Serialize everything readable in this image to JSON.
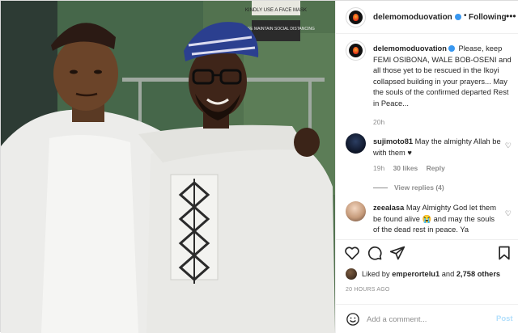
{
  "post": {
    "username": "delemomoduovation",
    "header_separator": "•",
    "follow_label": "Following",
    "more_icon": "more-icon",
    "photo_alt": "photo"
  },
  "caption": {
    "username": "delemomoduovation",
    "text": "Please, keep FEMI OSIBONA, WALE BOB-OSENI and all those yet to be rescued in the Ikoyi collapsed building in your prayers... May the souls of the confirmed departed Rest in Peace...",
    "time": "20h"
  },
  "comments": [
    {
      "username": "sujimoto81",
      "text": "May the almighty Allah be with them ♥",
      "time": "19h",
      "likes": "30 likes",
      "reply_label": "Reply",
      "view_replies": "View replies (4)"
    },
    {
      "username": "zeealasa",
      "text": "May Almighty God let them be found alive 😭 and may the souls of the dead rest in peace. Ya"
    }
  ],
  "actions": {
    "icons": [
      "heart-icon",
      "comment-icon",
      "share-icon",
      "bookmark-icon"
    ],
    "liked_by_prefix": "Liked by",
    "liked_by_user": "emperortelu1",
    "and_label": "and",
    "others_count": "2,758 others",
    "timestamp": "20 HOURS AGO"
  },
  "comment_box": {
    "placeholder": "Add a comment...",
    "post_label": "Post"
  },
  "photo_signs": {
    "sign1": "KINDLY USE A FACE MASK",
    "sign2": "PLEASE MAINTAIN SOCIAL DISTANCING"
  },
  "colors": {
    "verified": "#3897f0",
    "muted": "#8e8e8e",
    "post_disabled": "#b2dffc"
  }
}
